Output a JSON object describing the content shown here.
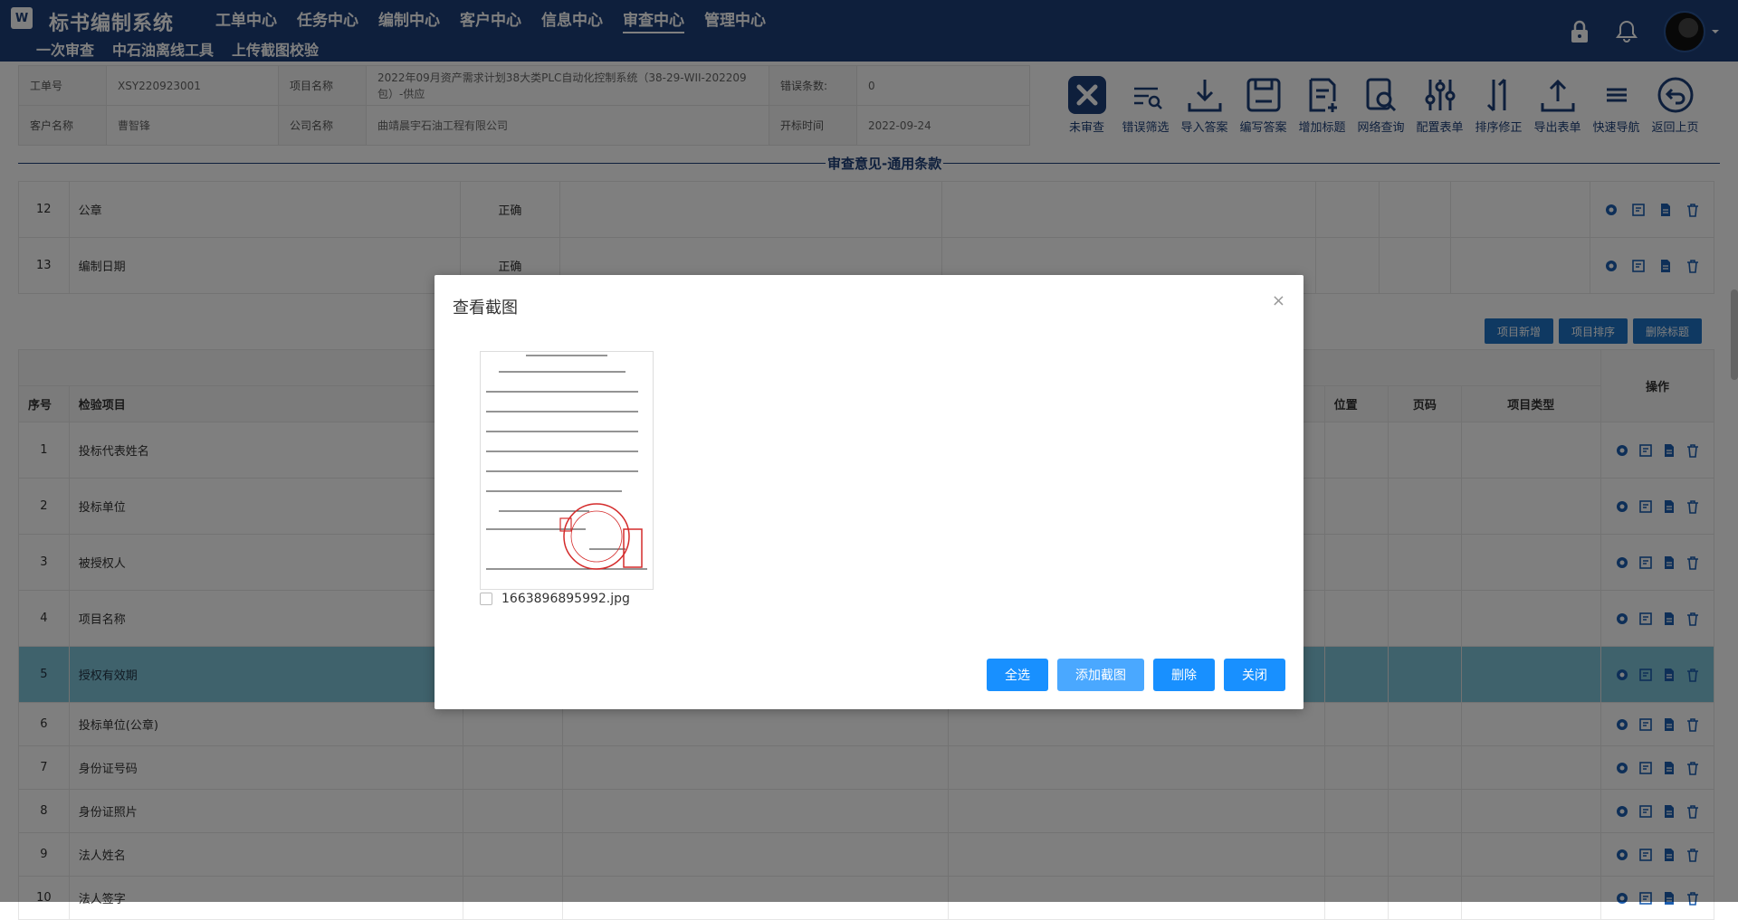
{
  "app": {
    "logo": "W",
    "title": "标书编制系统"
  },
  "nav": {
    "main": [
      "工单中心",
      "任务中心",
      "编制中心",
      "客户中心",
      "信息中心",
      "审查中心",
      "管理中心"
    ],
    "active_main": "审查中心",
    "sub": [
      "一次审查",
      "中石油离线工具",
      "上传截图校验"
    ],
    "active_sub": "一次审查"
  },
  "info": {
    "order_no_label": "工单号",
    "order_no": "XSY220923001",
    "project_name_label": "项目名称",
    "project_name": "2022年09月资产需求计划38大类PLC自动化控制系统（38-29-WII-202209包）-供应",
    "error_count_label": "错误条数:",
    "error_count": "0",
    "customer_label": "客户名称",
    "customer": "曹智锋",
    "company_label": "公司名称",
    "company": "曲靖晨宇石油工程有限公司",
    "bid_time_label": "开标时间",
    "bid_time": "2022-09-24"
  },
  "toolbar": [
    {
      "label": "未审查",
      "icon": "close-box-icon"
    },
    {
      "label": "错误筛选",
      "icon": "filter-list-icon"
    },
    {
      "label": "导入答案",
      "icon": "import-icon"
    },
    {
      "label": "编写答案",
      "icon": "save-icon"
    },
    {
      "label": "增加标题",
      "icon": "add-doc-icon"
    },
    {
      "label": "网络查询",
      "icon": "search-doc-icon"
    },
    {
      "label": "配置表单",
      "icon": "sliders-icon"
    },
    {
      "label": "排序修正",
      "icon": "sort-icon"
    },
    {
      "label": "导出表单",
      "icon": "export-icon"
    },
    {
      "label": "快速导航",
      "icon": "menu-icon"
    },
    {
      "label": "返回上页",
      "icon": "back-icon"
    }
  ],
  "section_title": "审查意见-通用条款",
  "top_rows": [
    {
      "no": "12",
      "item": "公章",
      "result": "正确"
    },
    {
      "no": "13",
      "item": "编制日期",
      "result": "正确"
    }
  ],
  "table_buttons": [
    "项目新增",
    "项目排序",
    "删除标题"
  ],
  "headers": {
    "no": "序号",
    "item": "检验项目",
    "position": "位置",
    "page": "页码",
    "type": "项目类型",
    "ops": "操作"
  },
  "rows": [
    {
      "no": "1",
      "item": "投标代表姓名"
    },
    {
      "no": "2",
      "item": "投标单位"
    },
    {
      "no": "3",
      "item": "被授权人"
    },
    {
      "no": "4",
      "item": "项目名称"
    },
    {
      "no": "5",
      "item": "授权有效期"
    },
    {
      "no": "6",
      "item": "投标单位(公章)"
    },
    {
      "no": "7",
      "item": "身份证号码"
    },
    {
      "no": "8",
      "item": "身份证照片"
    },
    {
      "no": "9",
      "item": "法人姓名"
    },
    {
      "no": "10",
      "item": "法人签字"
    }
  ],
  "modal": {
    "title": "查看截图",
    "close": "×",
    "file_name": "1663896895992.jpg",
    "buttons": {
      "select_all": "全选",
      "add": "添加截图",
      "delete": "删除",
      "close": "关闭"
    }
  },
  "colors": {
    "nav": "#1d3f78",
    "primary": "#1890ff",
    "highlight_row": "#7ec4d9"
  }
}
